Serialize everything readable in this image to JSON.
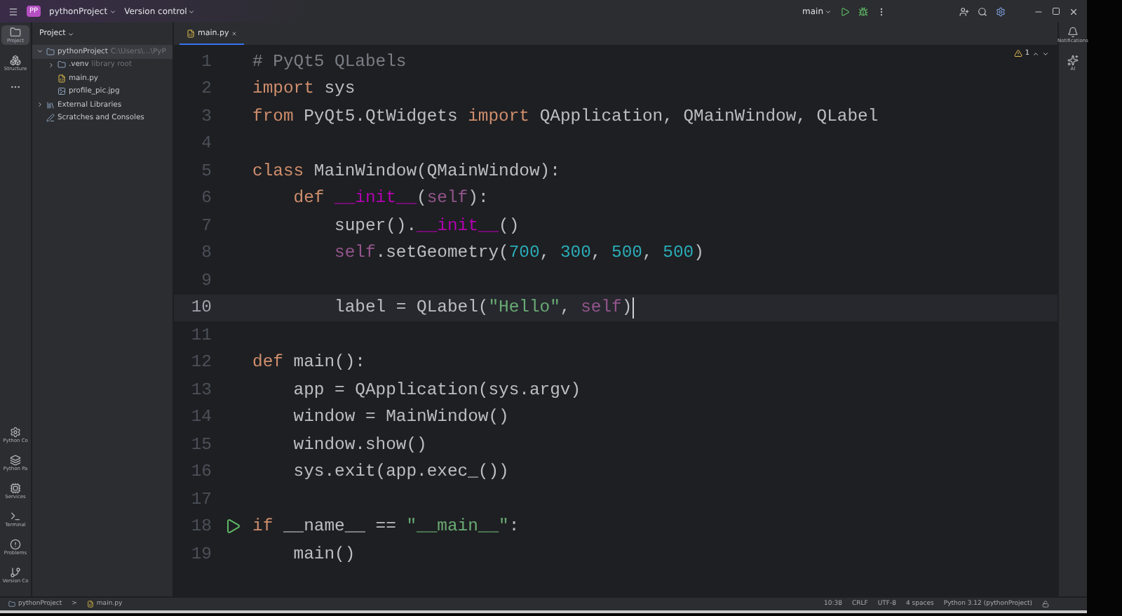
{
  "title_bar": {
    "badge": "PP",
    "project": "pythonProject",
    "vcs": "Version control",
    "branch": "main"
  },
  "tool_strip": {
    "top": [
      {
        "label": "Project",
        "selected": true
      },
      {
        "label": "Structure",
        "selected": false
      }
    ],
    "bottom": [
      {
        "label": "Python Co"
      },
      {
        "label": "Python Pa"
      },
      {
        "label": "Services"
      },
      {
        "label": "Terminal"
      },
      {
        "label": "Problems"
      },
      {
        "label": "Version Co"
      }
    ]
  },
  "project_panel": {
    "title": "Project",
    "tree": [
      {
        "name": "pythonProject",
        "note": "C:\\Users\\...\\PyP",
        "kind": "folder",
        "expanded": true,
        "selected": true,
        "children": [
          {
            "name": ".venv",
            "note": "library root",
            "kind": "folder",
            "expanded": false,
            "selected": false
          },
          {
            "name": "main.py",
            "kind": "python",
            "selected": false
          },
          {
            "name": "profile_pic.jpg",
            "kind": "image",
            "selected": false
          }
        ]
      },
      {
        "name": "External Libraries",
        "kind": "library",
        "expanded": false,
        "selected": false
      },
      {
        "name": "Scratches and Consoles",
        "kind": "scratch",
        "selected": false
      }
    ]
  },
  "editor": {
    "tabs": [
      {
        "label": "main.py",
        "selected": true
      }
    ],
    "warnings": "1",
    "lines": [
      {
        "number": "1",
        "tokens": [
          {
            "kind": "comment",
            "text": "# PyQt5 QLabels"
          }
        ]
      },
      {
        "number": "2",
        "tokens": [
          {
            "kind": "keyword",
            "text": "import"
          },
          {
            "kind": "plain",
            "text": " sys"
          }
        ]
      },
      {
        "number": "3",
        "tokens": [
          {
            "kind": "keyword",
            "text": "from"
          },
          {
            "kind": "plain",
            "text": " PyQt5.QtWidgets "
          },
          {
            "kind": "keyword",
            "text": "import"
          },
          {
            "kind": "plain",
            "text": " QApplication, QMainWindow, QLabel"
          }
        ]
      },
      {
        "number": "4"
      },
      {
        "number": "5",
        "tokens": [
          {
            "kind": "keyword",
            "text": "class"
          },
          {
            "kind": "plain",
            "text": " MainWindow(QMainWindow):"
          }
        ]
      },
      {
        "number": "6",
        "tokens": [
          {
            "kind": "keyword",
            "text": "    def"
          },
          {
            "kind": "dunder",
            "text": " __init__"
          },
          {
            "kind": "plain",
            "text": "("
          },
          {
            "kind": "self",
            "text": "self"
          },
          {
            "kind": "plain",
            "text": "):"
          }
        ]
      },
      {
        "number": "7",
        "tokens": [
          {
            "kind": "plain",
            "text": "        super()."
          },
          {
            "kind": "dunder",
            "text": "__init__"
          },
          {
            "kind": "plain",
            "text": "()"
          }
        ]
      },
      {
        "number": "8",
        "tokens": [
          {
            "kind": "self",
            "text": "        self"
          },
          {
            "kind": "plain",
            "text": ".setGeometry("
          },
          {
            "kind": "number",
            "text": "700"
          },
          {
            "kind": "plain",
            "text": ", "
          },
          {
            "kind": "number",
            "text": "300"
          },
          {
            "kind": "plain",
            "text": ", "
          },
          {
            "kind": "number",
            "text": "500"
          },
          {
            "kind": "plain",
            "text": ", "
          },
          {
            "kind": "number",
            "text": "500"
          },
          {
            "kind": "plain",
            "text": ")"
          }
        ]
      },
      {
        "number": "9"
      },
      {
        "number": "10",
        "current": true,
        "tokens": [
          {
            "kind": "plain",
            "text": "        label = QLabel("
          },
          {
            "kind": "string",
            "text": "\"Hello\""
          },
          {
            "kind": "plain",
            "text": ", "
          },
          {
            "kind": "self",
            "text": "self"
          },
          {
            "kind": "plain",
            "text": ")"
          }
        ]
      },
      {
        "number": "11"
      },
      {
        "number": "12",
        "tokens": [
          {
            "kind": "keyword",
            "text": "def"
          },
          {
            "kind": "plain",
            "text": " main():"
          }
        ]
      },
      {
        "number": "13",
        "tokens": [
          {
            "kind": "plain",
            "text": "    app = QApplication(sys.argv)"
          }
        ]
      },
      {
        "number": "14",
        "tokens": [
          {
            "kind": "plain",
            "text": "    window = MainWindow()"
          }
        ]
      },
      {
        "number": "15",
        "tokens": [
          {
            "kind": "plain",
            "text": "    window.show()"
          }
        ]
      },
      {
        "number": "16",
        "tokens": [
          {
            "kind": "plain",
            "text": "    sys.exit(app.exec_())"
          }
        ]
      },
      {
        "number": "17"
      },
      {
        "number": "18",
        "run": true,
        "tokens": [
          {
            "kind": "keyword",
            "text": "if"
          },
          {
            "kind": "plain",
            "text": " __name__ == "
          },
          {
            "kind": "string",
            "text": "\"__main__\""
          },
          {
            "kind": "plain",
            "text": ":"
          }
        ]
      },
      {
        "number": "19",
        "tokens": [
          {
            "kind": "plain",
            "text": "    main()"
          }
        ]
      }
    ]
  },
  "right_strip": [
    {
      "label": "Notifications"
    },
    {
      "label": "AI"
    }
  ],
  "status_bar": {
    "breadcrumb": [
      {
        "label": "pythonProject",
        "kind": "folder"
      },
      {
        "label": "main.py",
        "kind": "python"
      }
    ],
    "separator": ">",
    "items": [
      "10:38",
      "CRLF",
      "UTF-8",
      "4 spaces",
      "Python 3.12 (pythonProject)"
    ]
  }
}
